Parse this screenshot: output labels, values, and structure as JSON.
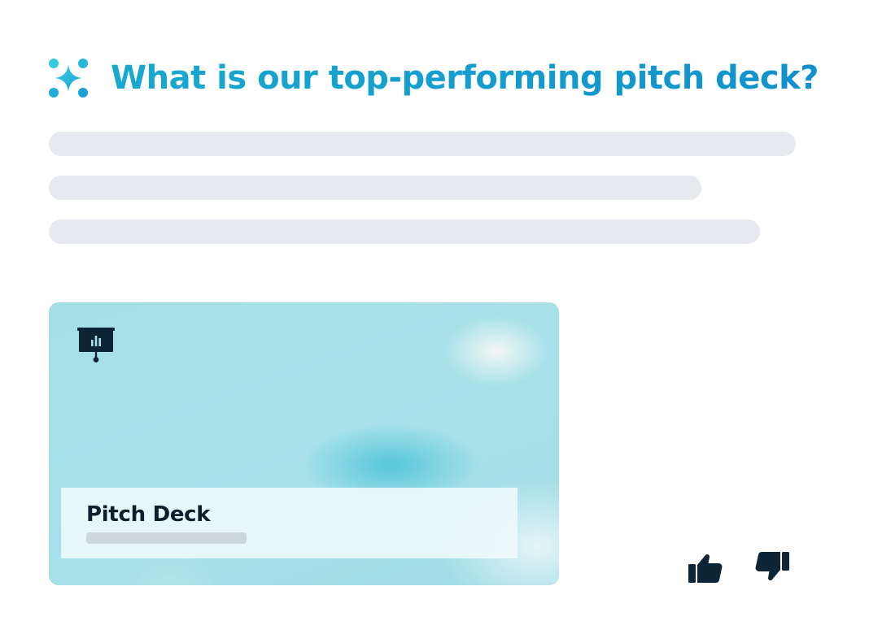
{
  "question": {
    "text": "What is our top-performing pitch deck?",
    "icon": "sparkle-icon",
    "gradient_colors": [
      "#3ad0de",
      "#1a9fd6"
    ]
  },
  "answer": {
    "skeleton_line_count": 3,
    "skeleton_color": "#e6e9ee"
  },
  "result_card": {
    "icon": "presentation-board-icon",
    "title": "Pitch Deck",
    "background_color": "#a7e0e8"
  },
  "feedback": {
    "thumbs_up_icon": "thumbs-up-icon",
    "thumbs_down_icon": "thumbs-down-icon",
    "icon_color": "#0d2436"
  }
}
